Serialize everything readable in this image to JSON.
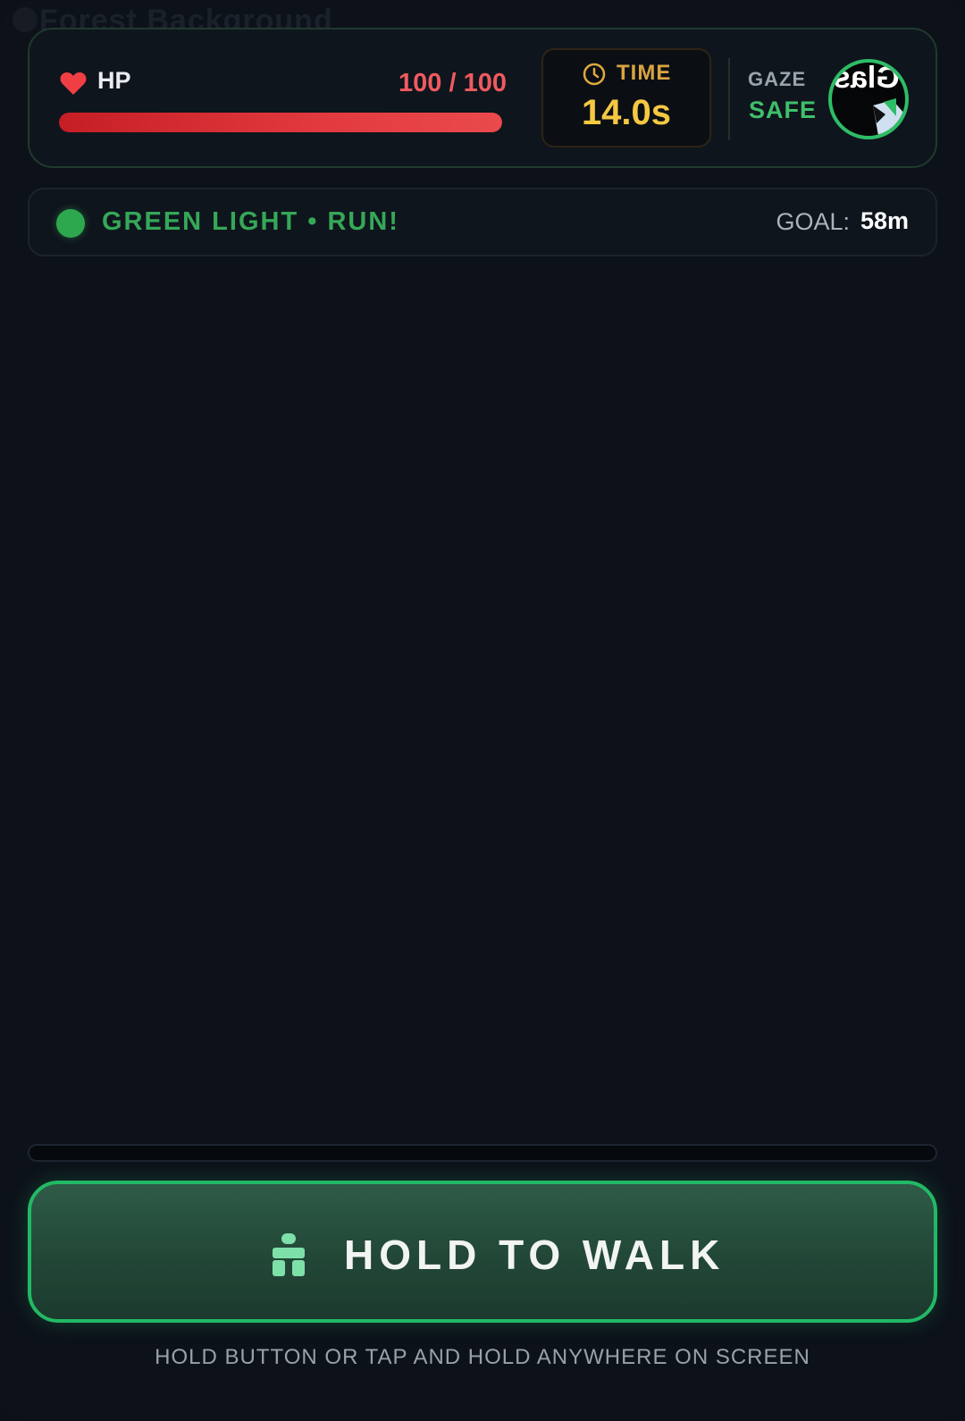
{
  "background_title": "Forest Background",
  "hud": {
    "hp_label": "HP",
    "hp_value": "100 / 100",
    "hp_fraction": 1.0,
    "time_label": "TIME",
    "time_value": "14.0s",
    "gaze_label": "GAZE",
    "gaze_state": "SAFE",
    "camera_text": "Glas"
  },
  "status": {
    "text": "GREEN LIGHT • RUN!",
    "goal_label": "GOAL:",
    "goal_value": "58m"
  },
  "progress_fraction": 0,
  "action": {
    "button_label": "HOLD TO WALK",
    "hint": "HOLD BUTTON OR TAP AND HOLD ANYWHERE ON SCREEN"
  },
  "icons": {
    "hp": "heart-icon",
    "time": "clock-icon",
    "status": "green-light-dot",
    "walk": "walking-figure-icon"
  },
  "colors": {
    "background": "#0d121a",
    "hp_red": "#e23a3e",
    "time_gold": "#f5c842",
    "safe_green": "#3fbf6b",
    "button_border": "#22b965"
  }
}
